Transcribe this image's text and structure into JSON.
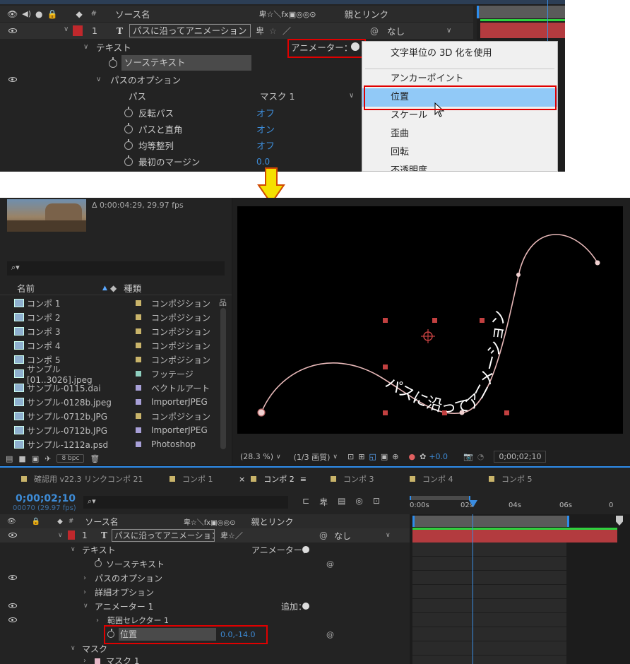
{
  "top": {
    "header": {
      "col_source_name": "ソース名",
      "col_switches": "卑☆＼fx▣◎◎⊙",
      "col_parent": "親とリンク"
    },
    "layer": {
      "index": "1",
      "type_icon": "T",
      "name": "パスに沿ってアニメーション",
      "parent_value": "なし"
    },
    "rows": [
      {
        "label": "テキスト",
        "animator_label": "アニメーター："
      },
      {
        "label": "ソーステキスト"
      },
      {
        "label": "パスのオプション"
      },
      {
        "label": "パス",
        "value": "マスク 1"
      },
      {
        "label": "反転パス",
        "value": "オフ"
      },
      {
        "label": "パスと直角",
        "value": "オン"
      },
      {
        "label": "均等整列",
        "value": "オフ"
      },
      {
        "label": "最初のマージン",
        "value": "0.0"
      }
    ],
    "menu": {
      "items": [
        "文字単位の 3D 化を使用",
        "アンカーポイント",
        "位置",
        "スケール",
        "歪曲",
        "回転",
        "不透明度"
      ],
      "highlighted": "位置"
    }
  },
  "arrow_color": "#f5e000",
  "project": {
    "thumb_info": "Δ 0:00:04:29, 29.97 fps",
    "search_icon": "search-icon",
    "col_name": "名前",
    "col_type": "種類",
    "items": [
      {
        "name": "コンポ 1",
        "type": "コンポジション",
        "color": "#c9b46a"
      },
      {
        "name": "コンポ 2",
        "type": "コンポジション",
        "color": "#c9b46a"
      },
      {
        "name": "コンポ 3",
        "type": "コンポジション",
        "color": "#c9b46a"
      },
      {
        "name": "コンポ 4",
        "type": "コンポジション",
        "color": "#c9b46a"
      },
      {
        "name": "コンポ 5",
        "type": "コンポジション",
        "color": "#c9b46a"
      },
      {
        "name": "サンプル[01..3026].jpeg",
        "type": "フッテージ",
        "color": "#8fd0c0"
      },
      {
        "name": "サンプル-0115.dai",
        "type": "ベクトルアート",
        "color": "#a8a0d8"
      },
      {
        "name": "サンプル-0128b.jpeg",
        "type": "ImporterJPEG",
        "color": "#a8a0d8"
      },
      {
        "name": "サンプル-0712b.JPG",
        "type": "コンポジション",
        "color": "#c9b46a"
      },
      {
        "name": "サンプル-0712b.JPG",
        "type": "ImporterJPEG",
        "color": "#a8a0d8"
      },
      {
        "name": "サンプル-1212a.psd",
        "type": "Photoshop",
        "color": "#a8a0d8"
      }
    ],
    "bpc": "8 bpc"
  },
  "viewer": {
    "path_text": "パスに沿ってアニメーション",
    "zoom": "(28.3 %)",
    "resolution": "(1/3 画質)",
    "exposure": "+0.0",
    "timecode": "0;00;02;10"
  },
  "timeline": {
    "tabs": [
      {
        "label": "確認用 v22.3 リンクコンポ 21",
        "color": "#c9b46a"
      },
      {
        "label": "コンポ 1",
        "color": "#c9b46a"
      },
      {
        "label": "コンポ 2",
        "color": "#c9b46a",
        "active": true
      },
      {
        "label": "コンポ 3",
        "color": "#c9b46a"
      },
      {
        "label": "コンポ 4",
        "color": "#c9b46a"
      },
      {
        "label": "コンポ 5",
        "color": "#c9b46a"
      }
    ],
    "timecode": "0;00;02;10",
    "frames": "00070 (29.97 fps)",
    "ruler": [
      "0:00s",
      "02s",
      "04s",
      "06s",
      "0"
    ],
    "header": {
      "col_source_name": "ソース名",
      "col_parent": "親とリンク"
    },
    "layer": {
      "index": "1",
      "type_icon": "T",
      "name": "パスに沿ってアニメーション",
      "parent_value": "なし"
    },
    "rows": [
      {
        "label": "テキスト",
        "animator_label": "アニメーター："
      },
      {
        "label": "ソーステキスト"
      },
      {
        "label": "パスのオプション"
      },
      {
        "label": "詳細オプション"
      },
      {
        "label": "アニメーター 1",
        "add_label": "追加："
      },
      {
        "label": "範囲セレクター 1"
      },
      {
        "label": "位置",
        "value": "0.0,-14.0"
      },
      {
        "label": "マスク"
      },
      {
        "label": "マスク 1"
      }
    ]
  }
}
